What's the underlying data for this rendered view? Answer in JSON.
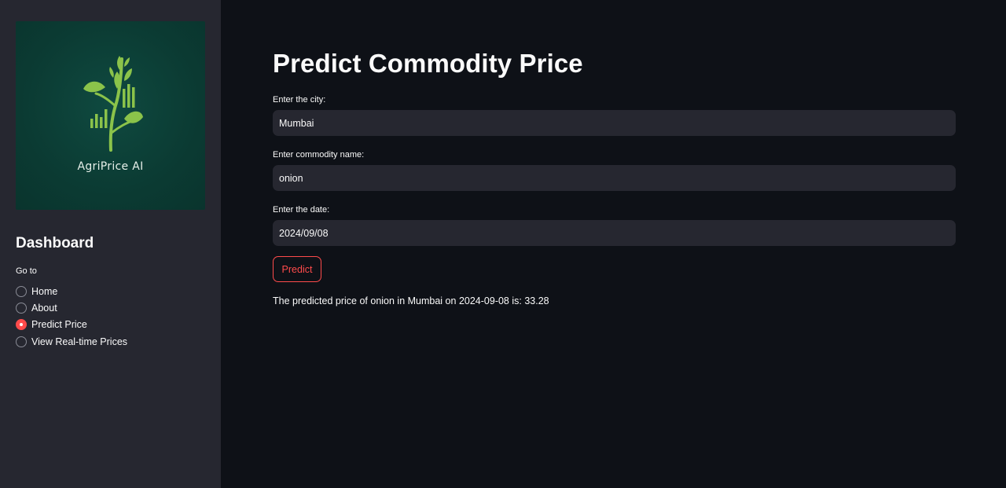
{
  "sidebar": {
    "logo_text": "AgriPrice AI",
    "title": "Dashboard",
    "nav_label": "Go to",
    "nav_items": [
      {
        "label": "Home",
        "selected": false
      },
      {
        "label": "About",
        "selected": false
      },
      {
        "label": "Predict Price",
        "selected": true
      },
      {
        "label": "View Real-time Prices",
        "selected": false
      }
    ]
  },
  "main": {
    "title": "Predict Commodity Price",
    "city": {
      "label": "Enter the city:",
      "value": "Mumbai"
    },
    "commodity": {
      "label": "Enter commodity name:",
      "value": "onion"
    },
    "date": {
      "label": "Enter the date:",
      "value": "2024/09/08"
    },
    "predict_label": "Predict",
    "result": "The predicted price of onion in Mumbai on 2024-09-08 is: 33.28"
  },
  "colors": {
    "background": "#0e1117",
    "sidebar": "#262730",
    "accent": "#ff4b4b",
    "logo_bg": "#0b3b33",
    "logo_leaf": "#8bc34a"
  },
  "icons": {
    "logo": "plant-bar-chart-icon"
  }
}
